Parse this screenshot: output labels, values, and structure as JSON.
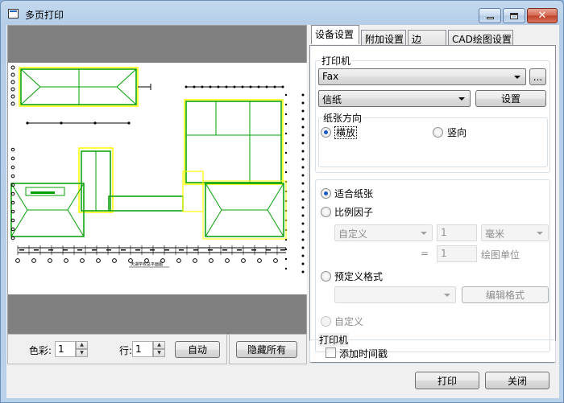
{
  "window": {
    "title": "多页打印"
  },
  "preview": {
    "color_label": "色彩:",
    "color_value": "1",
    "row_label": "行:",
    "row_value": "1",
    "auto_button": "自动",
    "hide_all_button": "隐藏所有",
    "drawing_caption": "天湖学校总平面图"
  },
  "tabs": [
    {
      "label": "设备设置",
      "active": true
    },
    {
      "label": "附加设置",
      "active": false
    },
    {
      "label": "边",
      "active": false
    },
    {
      "label": "CAD绘图设置",
      "active": false
    }
  ],
  "printer_group": {
    "label": "打印机",
    "printer": "Fax",
    "more_button": "...",
    "paper": "信纸",
    "settings_button": "设置"
  },
  "orientation": {
    "label": "纸张方向",
    "landscape": "横放",
    "portrait": "竖向",
    "selected": "landscape"
  },
  "scaling": {
    "fit_paper": "适合纸张",
    "scale_factor": "比例因子",
    "custom_combo": "自定义",
    "value1": "1",
    "unit": "毫米",
    "equals": "=",
    "value2": "1",
    "drawing_unit": "绘图单位",
    "predefined_format": "预定义格式",
    "predefined_combo": "",
    "edit_format_button": "编辑格式",
    "custom": "自定义",
    "selected": "fit_paper"
  },
  "bottom_printer": {
    "label": "打印机",
    "add_timestamp": "添加时间戳",
    "add_timestamp_checked": false
  },
  "footer": {
    "print_button": "打印",
    "close_button": "关闭"
  },
  "colors": {
    "drawing_green": "#00a000",
    "drawing_yellow": "#ffff00",
    "dim_black": "#000000",
    "radio_dot": "#1b59c4"
  },
  "icons": [
    "app-icon",
    "minimize-icon",
    "maximize-icon",
    "close-icon",
    "chevron-down-icon",
    "spin-up-icon",
    "spin-down-icon"
  ]
}
